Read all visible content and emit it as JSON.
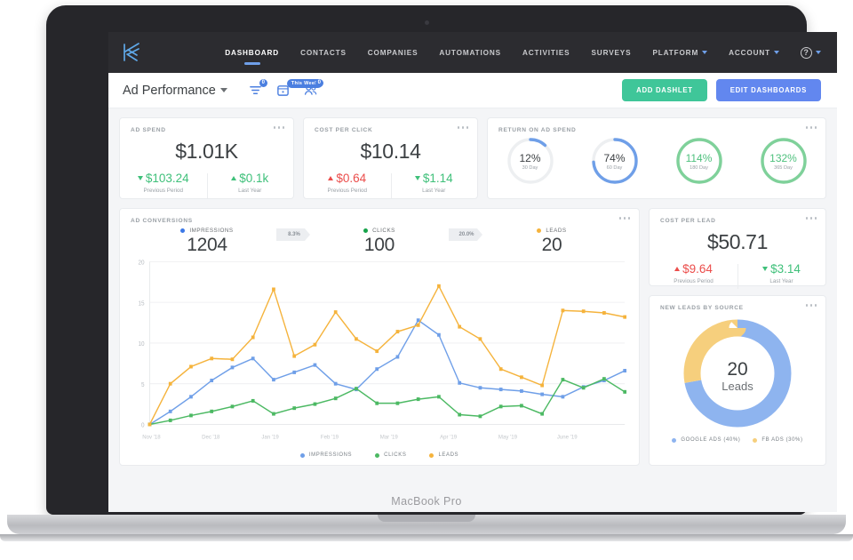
{
  "device": {
    "label": "MacBook Pro"
  },
  "topnav": {
    "logo_icon": "kickserv-logo-icon",
    "items": [
      {
        "label": "DASHBOARD",
        "active": true,
        "caret": false
      },
      {
        "label": "CONTACTS",
        "active": false,
        "caret": false
      },
      {
        "label": "COMPANIES",
        "active": false,
        "caret": false
      },
      {
        "label": "AUTOMATIONS",
        "active": false,
        "caret": false
      },
      {
        "label": "ACTIVITIES",
        "active": false,
        "caret": false
      },
      {
        "label": "SURVEYS",
        "active": false,
        "caret": false
      },
      {
        "label": "PLATFORM",
        "active": false,
        "caret": true
      },
      {
        "label": "ACCOUNT",
        "active": false,
        "caret": true
      }
    ],
    "help_glyph": "?"
  },
  "toolbar": {
    "dashboard_name": "Ad Performance",
    "filter_badge": "0",
    "date_pill": "This Week",
    "people_badge": "0",
    "add_dashlet_label": "ADD DASHLET",
    "edit_dashboards_label": "EDIT  DASHBOARDS"
  },
  "colors": {
    "impressions": "#6f9fe8",
    "clicks": "#4cb963",
    "leads": "#f5b33c",
    "red": "#eb4d4b",
    "green": "#3fc07a",
    "blue_accent": "#6287ef",
    "green_accent": "#3fc699"
  },
  "cards": {
    "ad_spend": {
      "title": "AD SPEND",
      "value": "$1.01K",
      "left": {
        "dir": "down",
        "value": "$103.24",
        "label": "Previous Period"
      },
      "right": {
        "dir": "up",
        "value": "$0.1k",
        "label": "Last Year"
      }
    },
    "cost_per_click": {
      "title": "COST PER CLICK",
      "value": "$10.14",
      "left": {
        "dir": "up",
        "value": "$0.64",
        "label": "Previous Period"
      },
      "right": {
        "dir": "down",
        "value": "$1.14",
        "label": "Last Year"
      }
    },
    "return_on_ad_spend": {
      "title": "RETURN ON AD SPEND",
      "gauges": [
        {
          "pct": "12%",
          "label": "30 Day",
          "fraction": 0.12,
          "color": "#6f9fe8",
          "green": false
        },
        {
          "pct": "74%",
          "label": "60 Day",
          "fraction": 0.74,
          "color": "#6f9fe8",
          "green": false
        },
        {
          "pct": "114%",
          "label": "180 Day",
          "fraction": 1.0,
          "color": "#7fd19a",
          "green": true
        },
        {
          "pct": "132%",
          "label": "365 Day",
          "fraction": 1.0,
          "color": "#7fd19a",
          "green": true
        }
      ]
    },
    "ad_conversions": {
      "title": "AD CONVERSIONS",
      "funnel": [
        {
          "label": "IMPRESSIONS",
          "value": "1204",
          "color": "#3b78e7"
        },
        {
          "label": "CLICKS",
          "value": "100",
          "color": "#16a34a"
        },
        {
          "label": "LEADS",
          "value": "20",
          "color": "#f5b33c"
        }
      ],
      "rates": [
        "8.3%",
        "20.0%"
      ]
    },
    "cost_per_lead": {
      "title": "COST PER LEAD",
      "value": "$50.71",
      "left": {
        "dir": "up",
        "value": "$9.64",
        "label": "Previous Period"
      },
      "right": {
        "dir": "down",
        "value": "$3.14",
        "label": "Last Year"
      }
    },
    "new_leads_by_source": {
      "title": "NEW LEADS BY SOURCE",
      "center_value": "20",
      "center_label": "Leads",
      "legend": [
        {
          "label": "GOOGLE ADS (40%)",
          "color": "#8eb4ef"
        },
        {
          "label": "FB ADS (30%)",
          "color": "#f6cf7d"
        }
      ],
      "slices": [
        {
          "name": "GOOGLE ADS",
          "value": 72,
          "color": "#8eb4ef"
        },
        {
          "name": "FB ADS",
          "value": 28,
          "color": "#f6cf7d"
        }
      ]
    }
  },
  "chart_data": {
    "type": "line",
    "title": "AD CONVERSIONS",
    "xlabel": "",
    "ylabel": "",
    "ylim": [
      0,
      20
    ],
    "yticks": [
      0,
      5,
      10,
      15,
      20
    ],
    "grid": true,
    "legend_position": "bottom",
    "x_tick_labels": [
      "Nov '18",
      "Dec '18",
      "Jan '19",
      "Feb '19",
      "Mar '19",
      "Apr '19",
      "May '19",
      "June '19"
    ],
    "x": [
      0,
      1,
      2,
      3,
      4,
      5,
      6,
      7,
      8,
      9,
      10,
      11,
      12,
      13,
      14,
      15,
      16,
      17,
      18,
      19,
      20,
      21,
      22,
      23
    ],
    "series": [
      {
        "name": "IMPRESSIONS",
        "color": "#6f9fe8",
        "values": [
          0,
          1.6,
          3.4,
          5.4,
          7.0,
          8.1,
          5.5,
          6.4,
          7.3,
          5.0,
          4.3,
          6.8,
          8.3,
          12.8,
          11.0,
          5.1,
          4.5,
          4.3,
          4.1,
          3.7,
          3.4,
          4.6,
          5.4,
          6.6
        ]
      },
      {
        "name": "CLICKS",
        "color": "#4cb963",
        "values": [
          0,
          0.5,
          1.1,
          1.6,
          2.2,
          2.9,
          1.3,
          2.0,
          2.5,
          3.2,
          4.4,
          2.6,
          2.6,
          3.1,
          3.4,
          1.2,
          1.0,
          2.2,
          2.3,
          1.3,
          5.5,
          4.5,
          5.6,
          4.0
        ]
      },
      {
        "name": "LEADS",
        "color": "#f5b33c",
        "values": [
          0,
          5.0,
          7.1,
          8.1,
          8.0,
          10.7,
          16.6,
          8.4,
          9.8,
          13.8,
          10.5,
          9.0,
          11.4,
          12.2,
          17.0,
          12.0,
          10.5,
          6.8,
          5.8,
          4.8,
          14.0,
          13.9,
          13.7,
          13.2
        ]
      }
    ]
  }
}
